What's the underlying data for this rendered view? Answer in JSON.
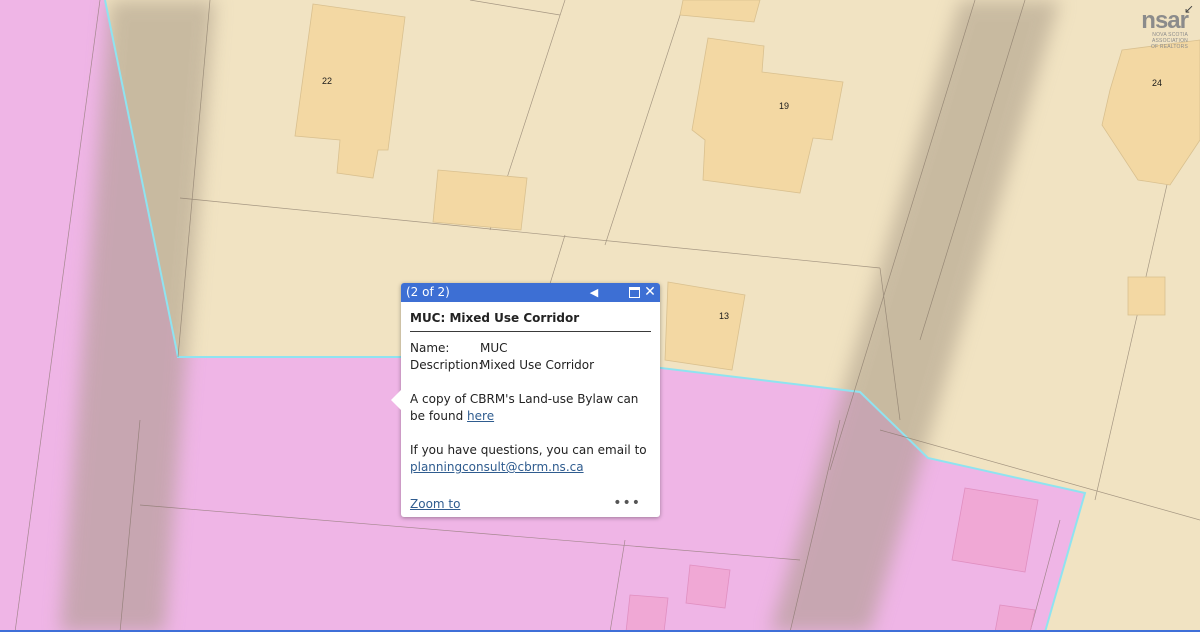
{
  "map": {
    "lot_numbers": [
      "22",
      "19",
      "24",
      "13"
    ],
    "colors": {
      "residential": "#f1e3c2",
      "building": "#f3d8a3",
      "muc_zone": "#efb5e6",
      "muc_building": "#f0a8d5",
      "zone_border": "#8fe3f0",
      "road_blur": "#a89a86"
    }
  },
  "logo": {
    "main": "nsar",
    "sub_line1": "NOVA SCOTIA ASSOCIATION",
    "sub_line2": "OF REALTORS"
  },
  "popup": {
    "counter": "(2 of 2)",
    "title": "MUC: Mixed Use Corridor",
    "attributes": [
      {
        "name": "Name:",
        "value": "MUC"
      },
      {
        "name": "Description:",
        "value": "Mixed Use Corridor"
      }
    ],
    "bylaw_text": "A copy of CBRM's Land-use Bylaw can be found",
    "bylaw_link": "here",
    "question_text": "If you have questions, you can email to",
    "email_link": "planningconsult@cbrm.ns.ca",
    "zoom_label": "Zoom to",
    "more_label": "•••"
  }
}
